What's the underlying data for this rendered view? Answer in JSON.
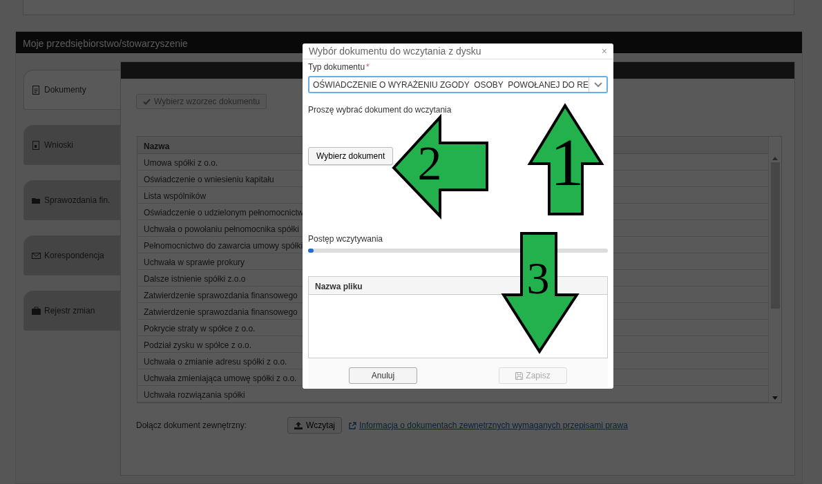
{
  "section_title": "Moje przedsiębiorstwo/stowarzyszenie",
  "sidebar": {
    "items": [
      {
        "label": "Dokumenty",
        "kind": "document",
        "selected": true
      },
      {
        "label": "Wnioski",
        "kind": "form",
        "selected": false
      },
      {
        "label": "Sprawozdania fin.",
        "kind": "folder",
        "selected": false
      },
      {
        "label": "Korespondencja",
        "kind": "mail",
        "selected": false
      },
      {
        "label": "Rejestr zmian",
        "kind": "briefcase",
        "selected": false
      }
    ]
  },
  "template_button": "Wybierz wzorzec dokumentu",
  "table": {
    "columns": [
      "Nazwa"
    ],
    "rows": [
      "Umowa spółki z o.o.",
      "Oświadczenie o wniesieniu kapitału",
      "Lista wspólników",
      "Oświadczenie o udzielonym pełnomocnictw",
      "Uchwała o powołaniu pełnomocnika spółki",
      "Pełnomocnictwo do zawarcia umowy spółki",
      "Uchwała w sprawie prokury",
      "Dalsze istnienie spółki z.o.o",
      "Zatwierdzenie sprawozdania finansowego",
      "Zatwierdzenie sprawozdania finansowego",
      "Pokrycie straty w spółce z o.o.",
      "Podział zysku w spółce z o.o.",
      "Uchwała o zmianie adresu spółki z o.o.",
      "Uchwała zmieniająca umowę spółki z o.o.",
      "Uchwała rozwiązania spółki"
    ]
  },
  "attach": {
    "label": "Dołącz dokument zewnętrzny:",
    "upload_button": "Wczytaj",
    "info_link": "Informacja o dokumentach zewnętrznych wymaganych przepisami prawa"
  },
  "dialog": {
    "title": "Wybór dokumentu do wczytania z dysku",
    "close": "×",
    "type_field": {
      "label": "Typ dokumentu",
      "required_mark": "*",
      "value": "OŚWIADCZENIE O WYRAŻENIU ZGODY  OSOBY  POWOŁANEJ DO RE"
    },
    "instruction": "Proszę wybrać dokument do wczytania",
    "choose_button": "Wybierz dokument",
    "progress": {
      "label": "Postęp wczytywania",
      "level": 0.01
    },
    "files_table": {
      "columns": [
        "Nazwa pliku"
      ]
    },
    "buttons": [
      {
        "label": "Anuluj",
        "kind": "plain",
        "disabled": false
      },
      {
        "label": "Zapisz",
        "kind": "save",
        "disabled": true
      }
    ]
  },
  "annotations": [
    {
      "label": "1",
      "kind": "up"
    },
    {
      "label": "2",
      "kind": "left"
    },
    {
      "label": "3",
      "kind": "down"
    }
  ]
}
